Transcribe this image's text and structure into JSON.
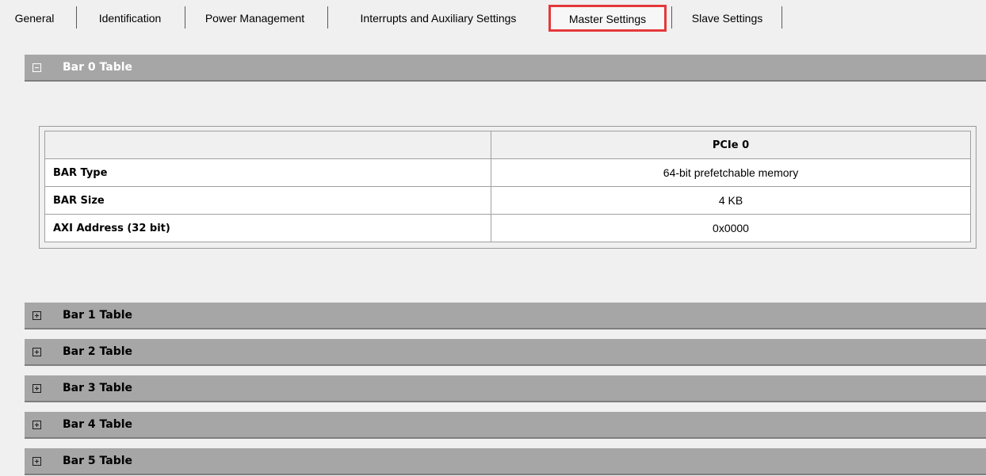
{
  "tabs": [
    {
      "label": "General",
      "active": false
    },
    {
      "label": "Identification",
      "active": false
    },
    {
      "label": "Power Management",
      "active": false
    },
    {
      "label": "Interrupts and Auxiliary Settings",
      "active": false
    },
    {
      "label": "Master Settings",
      "active": true
    },
    {
      "label": "Slave Settings",
      "active": false
    }
  ],
  "sections": [
    {
      "title": "Bar 0 Table",
      "expanded": true,
      "icon": "collapse-icon"
    },
    {
      "title": "Bar 1 Table",
      "expanded": false,
      "icon": "expand-icon"
    },
    {
      "title": "Bar 2 Table",
      "expanded": false,
      "icon": "expand-icon"
    },
    {
      "title": "Bar 3 Table",
      "expanded": false,
      "icon": "expand-icon"
    },
    {
      "title": "Bar 4 Table",
      "expanded": false,
      "icon": "expand-icon"
    },
    {
      "title": "Bar 5 Table",
      "expanded": false,
      "icon": "expand-icon"
    }
  ],
  "bar0_table": {
    "column_header": "PCIe 0",
    "rows": [
      {
        "label": "BAR Type",
        "value": "64-bit prefetchable memory"
      },
      {
        "label": "BAR Size",
        "value": "4 KB"
      },
      {
        "label": "AXI Address (32 bit)",
        "value": "0x0000"
      }
    ]
  },
  "colors": {
    "header_bg": "#a6a6a6",
    "highlight": "#e5383b"
  }
}
